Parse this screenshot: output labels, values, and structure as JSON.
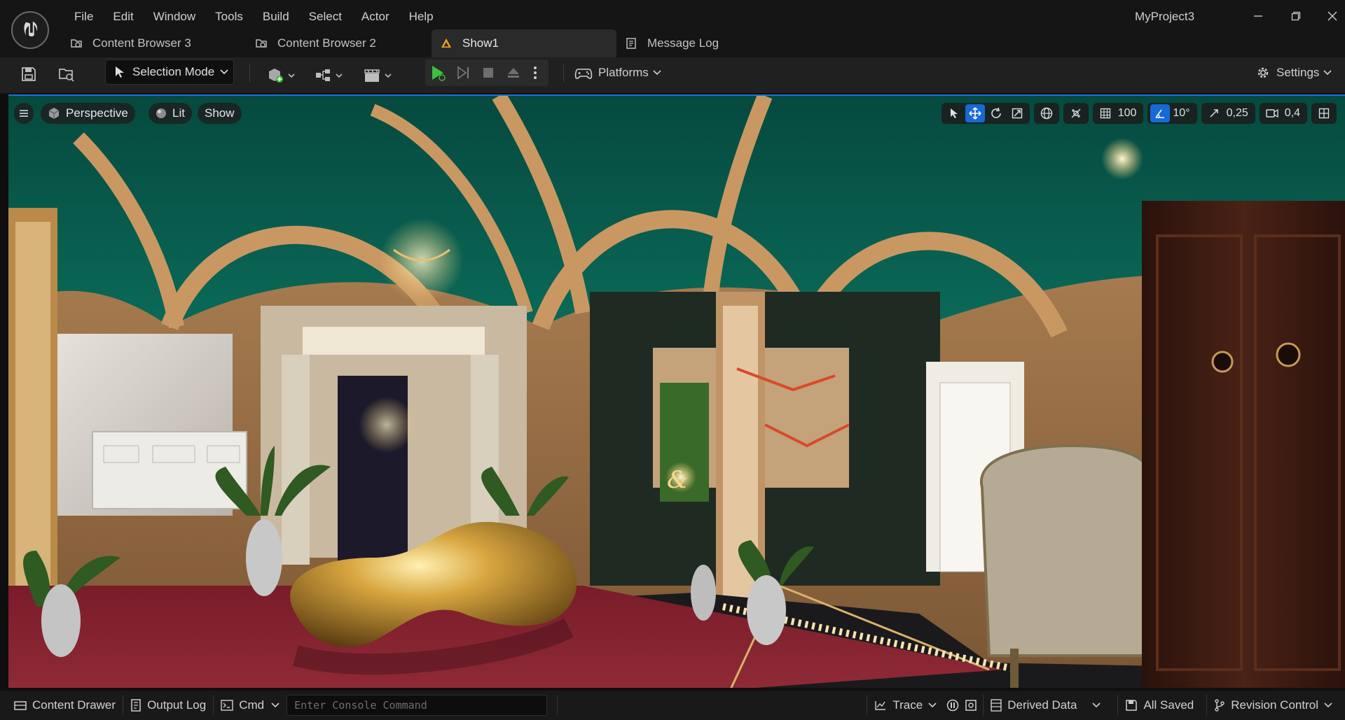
{
  "app": {
    "project_title": "MyProject3",
    "menu": [
      "File",
      "Edit",
      "Window",
      "Tools",
      "Build",
      "Select",
      "Actor",
      "Help"
    ],
    "tabs": [
      {
        "label": "Content Browser 3",
        "icon": "content-browser-icon",
        "active": false
      },
      {
        "label": "Content Browser 2",
        "icon": "content-browser-icon",
        "active": false
      },
      {
        "label": "Show1",
        "icon": "level-icon",
        "active": true
      },
      {
        "label": "Message Log",
        "icon": "message-log-icon",
        "active": false
      }
    ]
  },
  "toolbar": {
    "selection_mode": "Selection Mode",
    "platforms": "Platforms",
    "settings": "Settings"
  },
  "viewport": {
    "view_mode": "Perspective",
    "lighting": "Lit",
    "show": "Show",
    "grid_snap": "100",
    "rotation_snap": "10°",
    "scale_snap": "0,25",
    "camera_speed": "0,4"
  },
  "statusbar": {
    "content_drawer": "Content Drawer",
    "output_log": "Output Log",
    "cmd": "Cmd",
    "console_placeholder": "Enter Console Command",
    "trace": "Trace",
    "derived_data": "Derived Data",
    "all_saved": "All Saved",
    "revision_control": "Revision Control"
  },
  "colors": {
    "accent_blue": "#1769d6",
    "play_green": "#3fbf3f",
    "warning_orange": "#f0a020"
  }
}
